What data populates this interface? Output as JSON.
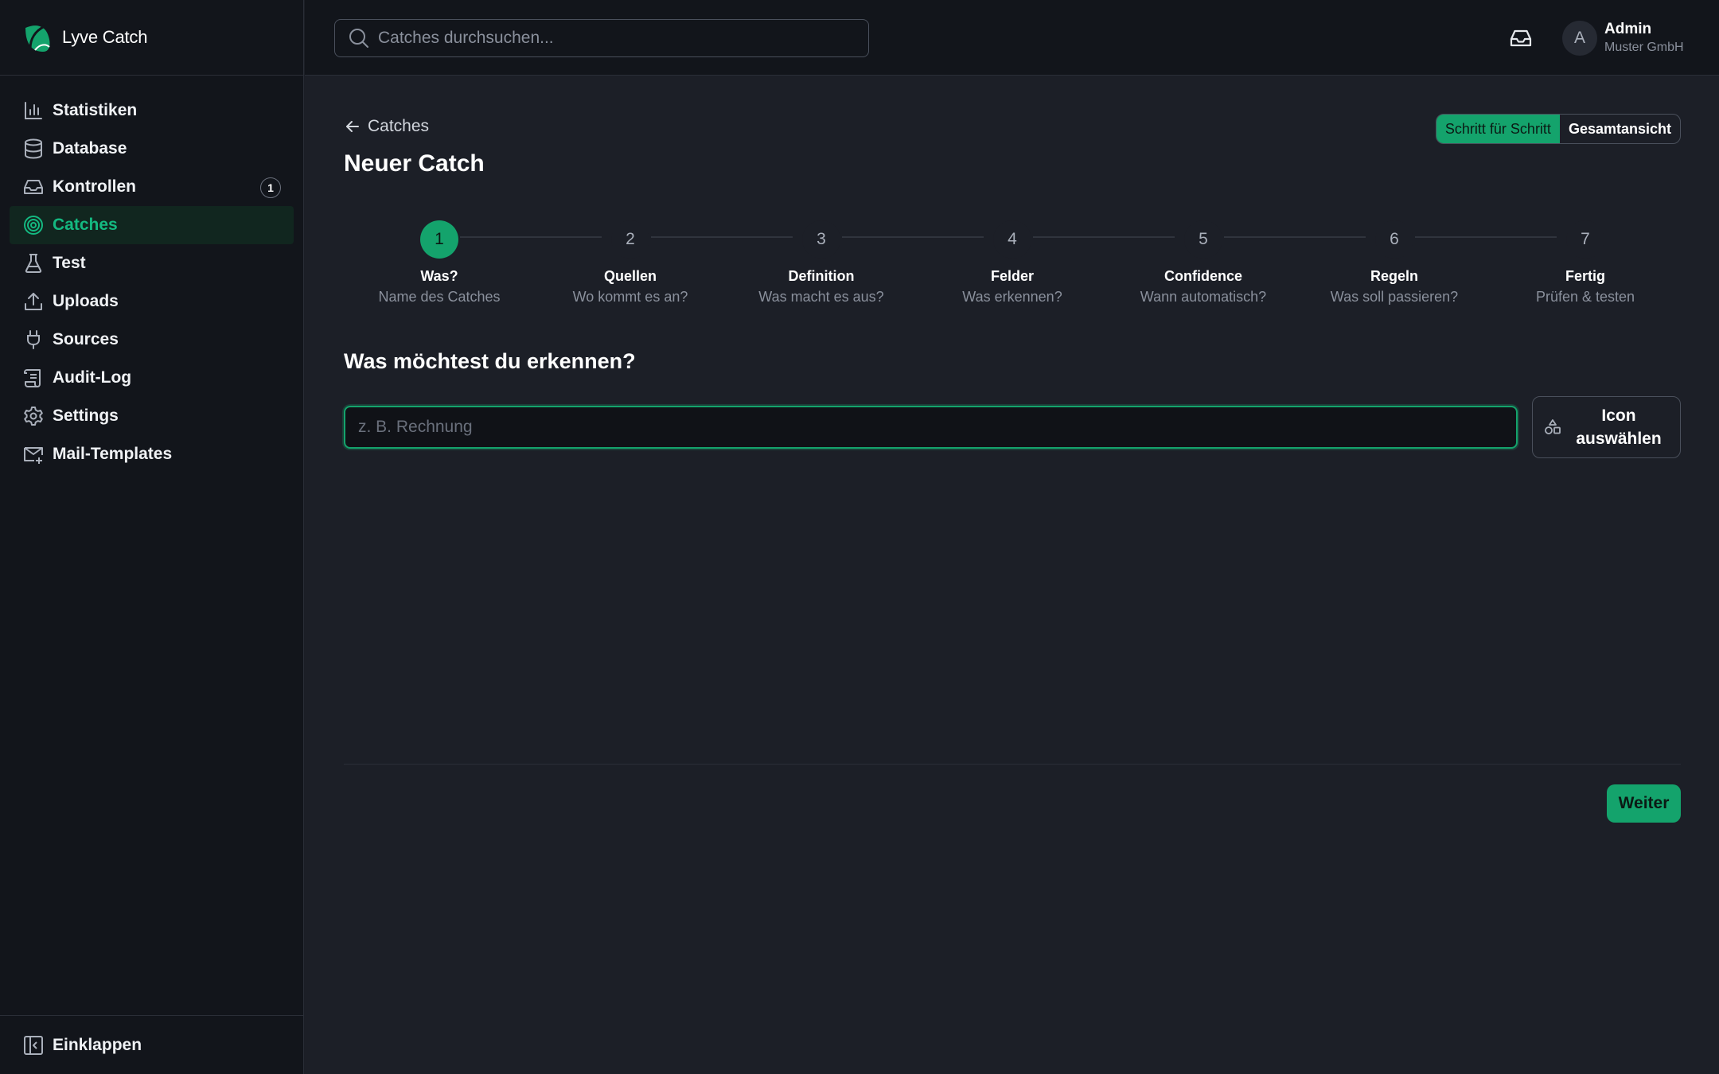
{
  "brand": {
    "name": "Lyve Catch",
    "accent": "#14a36c"
  },
  "sidebar": {
    "items": [
      {
        "label": "Statistiken",
        "icon": "bar-chart-icon"
      },
      {
        "label": "Database",
        "icon": "database-icon"
      },
      {
        "label": "Kontrollen",
        "icon": "inbox-icon",
        "badge": "1"
      },
      {
        "label": "Catches",
        "icon": "target-icon",
        "active": true
      },
      {
        "label": "Test",
        "icon": "flask-icon"
      },
      {
        "label": "Uploads",
        "icon": "upload-icon"
      },
      {
        "label": "Sources",
        "icon": "plug-icon"
      },
      {
        "label": "Audit-Log",
        "icon": "scroll-icon"
      },
      {
        "label": "Settings",
        "icon": "gear-icon"
      },
      {
        "label": "Mail-Templates",
        "icon": "mail-icon"
      }
    ],
    "collapse_label": "Einklappen"
  },
  "topbar": {
    "search_placeholder": "Catches durchsuchen...",
    "user": {
      "initial": "A",
      "name": "Admin",
      "org": "Muster GmbH"
    }
  },
  "page": {
    "back_label": "Catches",
    "title": "Neuer Catch",
    "view_toggle": {
      "step_label": "Schritt für Schritt",
      "overview_label": "Gesamtansicht"
    },
    "steps": [
      {
        "num": "1",
        "title": "Was?",
        "sub": "Name des Catches"
      },
      {
        "num": "2",
        "title": "Quellen",
        "sub": "Wo kommt es an?"
      },
      {
        "num": "3",
        "title": "Definition",
        "sub": "Was macht es aus?"
      },
      {
        "num": "4",
        "title": "Felder",
        "sub": "Was erkennen?"
      },
      {
        "num": "5",
        "title": "Confidence",
        "sub": "Wann automatisch?"
      },
      {
        "num": "6",
        "title": "Regeln",
        "sub": "Was soll passieren?"
      },
      {
        "num": "7",
        "title": "Fertig",
        "sub": "Prüfen & testen"
      }
    ],
    "question": "Was möchtest du erkennen?",
    "name_placeholder": "z. B. Rechnung",
    "icon_button_label": "Icon auswählen",
    "next_label": "Weiter"
  }
}
